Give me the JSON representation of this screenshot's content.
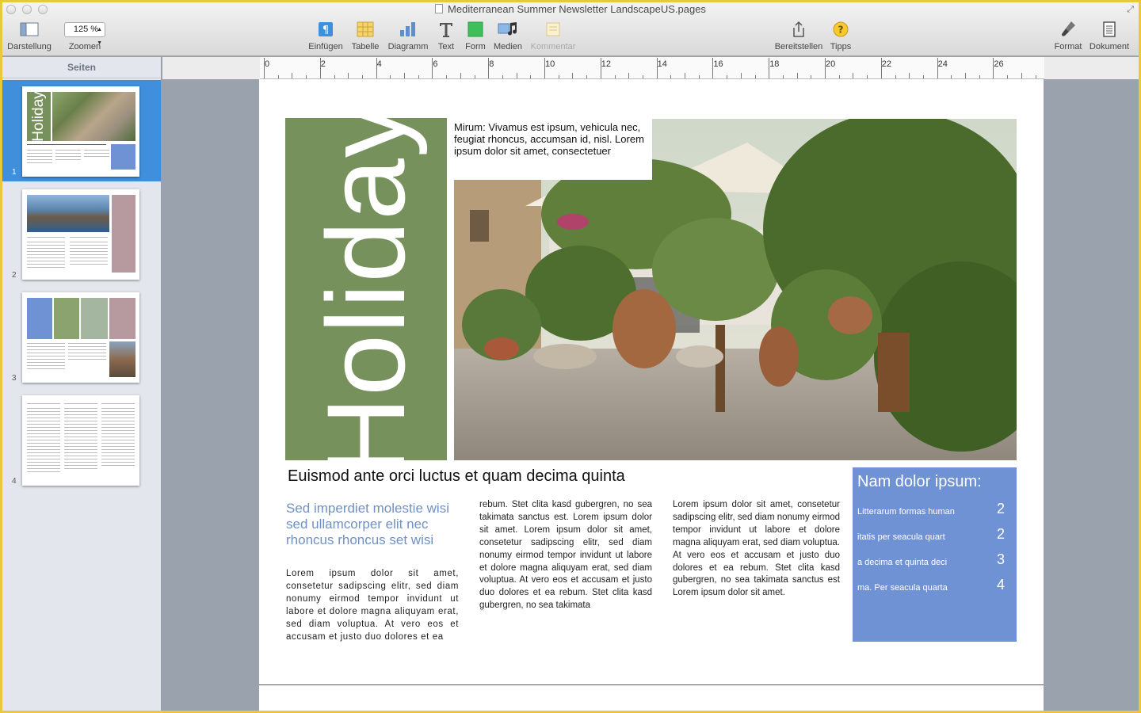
{
  "window": {
    "title": "Mediterranean Summer Newsletter LandscapeUS.pages"
  },
  "toolbar": {
    "view_label": "Darstellung",
    "zoom_value": "125 %",
    "zoom_label": "Zoomen",
    "insert_label": "Einfügen",
    "table_label": "Tabelle",
    "chart_label": "Diagramm",
    "text_label": "Text",
    "shape_label": "Form",
    "media_label": "Medien",
    "comment_label": "Kommentar",
    "share_label": "Bereitstellen",
    "tips_label": "Tipps",
    "format_label": "Format",
    "document_label": "Dokument"
  },
  "sidebar": {
    "header": "Seiten",
    "pages": [
      {
        "number": "1",
        "selected": true
      },
      {
        "number": "2",
        "selected": false
      },
      {
        "number": "3",
        "selected": false
      },
      {
        "number": "4",
        "selected": false
      }
    ],
    "thumb1_word": "Holiday"
  },
  "ruler": {
    "labels": [
      "0",
      "2",
      "4",
      "6",
      "8",
      "10",
      "12",
      "14",
      "16",
      "18",
      "20",
      "22",
      "24",
      "26"
    ]
  },
  "page": {
    "holiday": "Holiday",
    "intro": "Mirum: Vivamus est ipsum, vehicula nec, feugiat rhoncus, accumsan id, nisl. Lorem ipsum dolor sit amet, consectetuer",
    "headline": "Euismod ante orci luctus et quam decima quinta",
    "pull_quote": "Sed imperdiet molestie wisi sed ullamcorper elit nec rhoncus rhoncus set wisi",
    "col1": "Lorem ipsum dolor sit amet, consetetur sadipscing elitr, sed diam nonumy eirmod tempor invidunt ut labore et dolore magna aliquyam erat, sed diam voluptua. At vero eos et accusam et justo duo dolores et ea",
    "col2": "rebum. Stet clita kasd gubergren, no sea takimata sanctus est. Lorem ipsum dolor sit amet. Lorem ipsum dolor sit amet, consetetur sadipscing elitr, sed diam nonumy eirmod tempor invidunt ut labore et dolore magna aliquyam erat, sed diam voluptua. At vero eos et accusam et justo duo dolores et ea rebum. Stet clita kasd gubergren, no sea takimata",
    "col3": "Lorem ipsum dolor sit amet, consetetur sadipscing elitr, sed diam nonumy eirmod tempor invidunt ut labore et dolore magna aliquyam erat, sed diam voluptua. At vero eos et accusam et justo duo dolores et ea rebum. Stet clita kasd gubergren, no sea takimata sanctus est Lorem ipsum dolor sit amet.",
    "sidebox": {
      "title": "Nam dolor ipsum:",
      "rows": [
        {
          "text": "Litterarum formas human",
          "num": "2"
        },
        {
          "text": "itatis per seacula quart",
          "num": "2"
        },
        {
          "text": "a decima et quinta deci",
          "num": "3"
        },
        {
          "text": "ma. Per seacula quarta",
          "num": "4"
        }
      ]
    }
  },
  "colors": {
    "green": "#77915c",
    "blue_box": "#6f92d4",
    "pull_quote": "#6f91c4",
    "selection": "#3f8fdc"
  }
}
